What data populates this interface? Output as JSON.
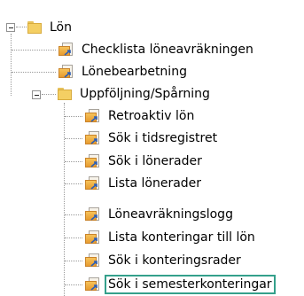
{
  "tree": {
    "root": {
      "label": "Lön",
      "icon": "folder-icon",
      "expanded": true
    },
    "root_children": [
      {
        "label": "Checklista löneavräkningen",
        "icon": "report-icon"
      },
      {
        "label": "Lönebearbetning",
        "icon": "report-icon"
      },
      {
        "label": "Uppföljning/Spårning",
        "icon": "folder-icon",
        "expanded": true
      }
    ],
    "sub_children": [
      {
        "label": "Retroaktiv lön",
        "icon": "report-icon"
      },
      {
        "label": "Sök i tidsregistret",
        "icon": "report-icon"
      },
      {
        "label": "Sök i lönerader",
        "icon": "report-icon"
      },
      {
        "label": "Lista lönerader",
        "icon": "report-icon"
      },
      {
        "label": "Löneavräkningslogg",
        "icon": "report-icon"
      },
      {
        "label": "Lista konteringar till lön",
        "icon": "report-icon"
      },
      {
        "label": "Sök i konteringsrader",
        "icon": "report-icon"
      },
      {
        "label": "Sök i semesterkonteringar",
        "icon": "report-icon",
        "selected": true
      }
    ],
    "selection_color": "#34a08b"
  }
}
